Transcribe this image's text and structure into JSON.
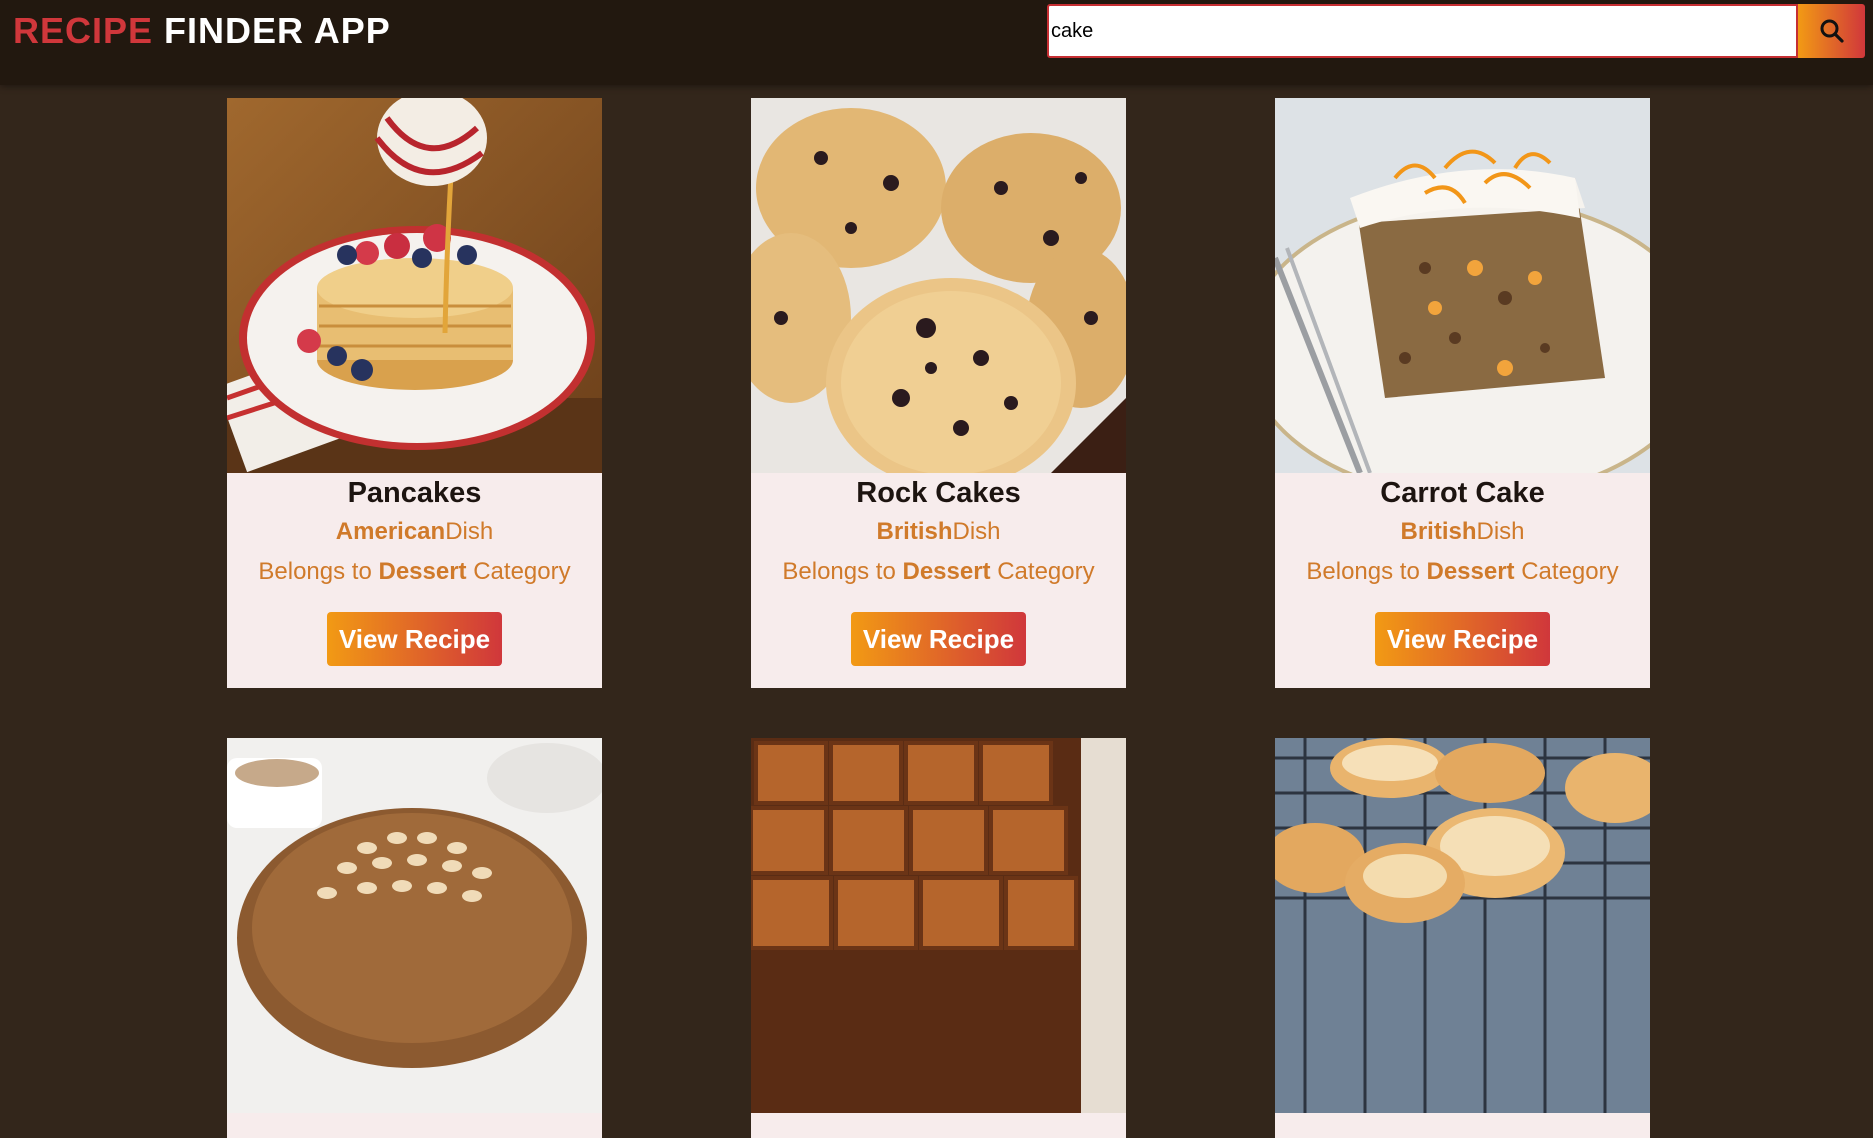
{
  "header": {
    "logo_accent": "RECIPE",
    "logo_rest": " FINDER APP"
  },
  "search": {
    "value": "cake",
    "button_icon": "search-icon"
  },
  "recipes": [
    {
      "name": "Pancakes",
      "area": "American",
      "area_suffix": "Dish",
      "category_prefix": "Belongs to ",
      "category": "Dessert",
      "category_suffix": " Category",
      "button": "View Recipe"
    },
    {
      "name": "Rock Cakes",
      "area": "British",
      "area_suffix": "Dish",
      "category_prefix": "Belongs to ",
      "category": "Dessert",
      "category_suffix": " Category",
      "button": "View Recipe"
    },
    {
      "name": "Carrot Cake",
      "area": "British",
      "area_suffix": "Dish",
      "category_prefix": "Belongs to ",
      "category": "Dessert",
      "category_suffix": " Category",
      "button": "View Recipe"
    }
  ],
  "colors": {
    "accent_red": "#d0373b",
    "accent_orange": "#f29a14",
    "text_orange": "#d07a2a",
    "card_bg": "#f7ecec",
    "page_bg": "#33261b"
  }
}
